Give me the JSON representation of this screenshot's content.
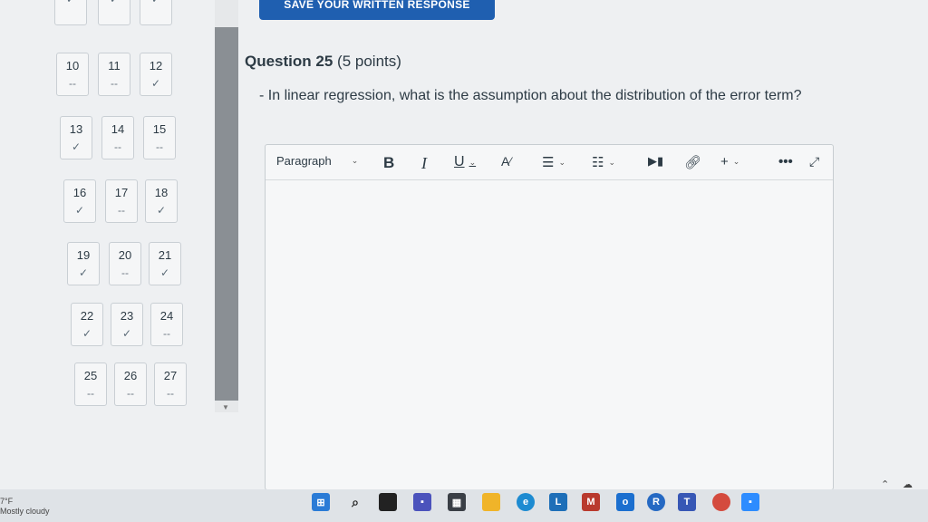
{
  "header": {
    "save_label": "SAVE YOUR WRITTEN RESPONSE"
  },
  "question_nav": [
    {
      "num": "",
      "status": "✓"
    },
    {
      "num": "",
      "status": "✓"
    },
    {
      "num": "",
      "status": "✓"
    },
    {
      "num": "10",
      "status": "--"
    },
    {
      "num": "11",
      "status": "--"
    },
    {
      "num": "12",
      "status": "✓"
    },
    {
      "num": "13",
      "status": "✓"
    },
    {
      "num": "14",
      "status": "--"
    },
    {
      "num": "15",
      "status": "--"
    },
    {
      "num": "16",
      "status": "✓"
    },
    {
      "num": "17",
      "status": "--"
    },
    {
      "num": "18",
      "status": "✓"
    },
    {
      "num": "19",
      "status": "✓"
    },
    {
      "num": "20",
      "status": "--"
    },
    {
      "num": "21",
      "status": "✓"
    },
    {
      "num": "22",
      "status": "✓"
    },
    {
      "num": "23",
      "status": "✓"
    },
    {
      "num": "24",
      "status": "--"
    },
    {
      "num": "25",
      "status": "--"
    },
    {
      "num": "26",
      "status": "--"
    },
    {
      "num": "27",
      "status": "--"
    }
  ],
  "question": {
    "title": "Question 25",
    "points": "(5 points)",
    "text": "- In linear regression, what is the assumption about the distribution of the error term?"
  },
  "editor": {
    "paragraph_label": "Paragraph",
    "bold": "B",
    "italic": "I",
    "underline": "U",
    "text_color": "A",
    "more": "•••",
    "body": ""
  },
  "taskbar": {
    "weather_temp": "7°F",
    "weather_desc": "Mostly cloudy"
  },
  "icons": {
    "bold": "bold-icon",
    "italic": "italic-icon",
    "underline": "underline-icon",
    "align": "align-icon",
    "list": "list-icon",
    "media": "media-icon",
    "link": "link-icon",
    "insert": "plus-icon",
    "expand": "expand-icon"
  }
}
